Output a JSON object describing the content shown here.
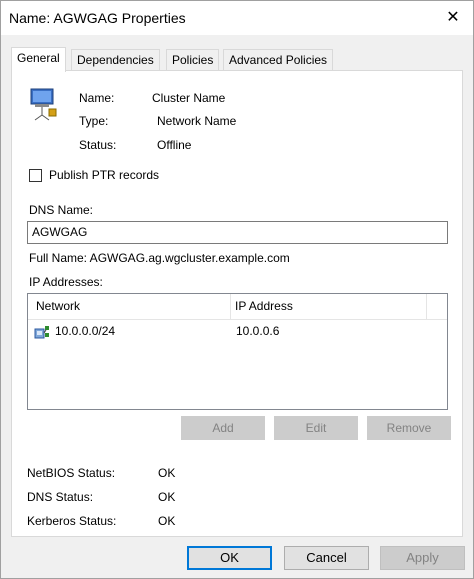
{
  "window": {
    "title": "Name: AGWGAG Properties",
    "close_glyph": "✕"
  },
  "tabs": [
    {
      "label": "General"
    },
    {
      "label": "Dependencies"
    },
    {
      "label": "Policies"
    },
    {
      "label": "Advanced Policies"
    }
  ],
  "resource": {
    "icon": "cluster-name-icon",
    "name_label": "Name:",
    "name_value": "Cluster Name",
    "type_label": "Type:",
    "type_value": "Network Name",
    "status_label": "Status:",
    "status_value": "Offline"
  },
  "publish_ptr": {
    "label": "Publish PTR records",
    "checked": false
  },
  "dns_name": {
    "label": "DNS Name:",
    "value": "AGWGAG"
  },
  "full_name": "Full Name: AGWGAG.ag.wgcluster.example.com",
  "ip_addresses": {
    "label": "IP Addresses:",
    "columns": [
      "Network",
      "IP Address"
    ],
    "rows": [
      {
        "icon": "network-icon",
        "network": "10.0.0.0/24",
        "ip": "10.0.0.6"
      }
    ],
    "add_label": "Add",
    "edit_label": "Edit",
    "remove_label": "Remove"
  },
  "status": {
    "netbios_label": "NetBIOS Status:",
    "netbios_value": "OK",
    "dns_label": "DNS Status:",
    "dns_value": "OK",
    "kerberos_label": "Kerberos Status:",
    "kerberos_value": "OK"
  },
  "footer": {
    "ok_label": "OK",
    "cancel_label": "Cancel",
    "apply_label": "Apply"
  }
}
